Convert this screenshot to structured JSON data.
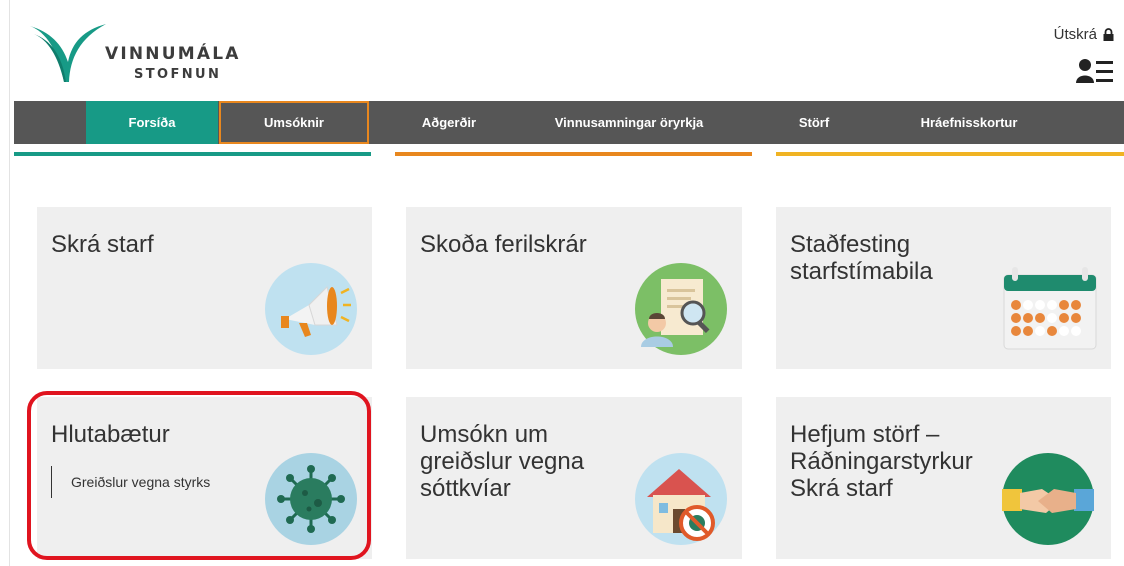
{
  "brand": {
    "line1": "VINNUMÁLA",
    "line2": "STOFNUN"
  },
  "header": {
    "logout_label": "Útskrá",
    "lock_icon": "lock-icon",
    "profile_icon": "profile-list-icon"
  },
  "nav": {
    "items": [
      {
        "label": "Forsíða",
        "state": "active"
      },
      {
        "label": "Umsóknir",
        "state": "outlined"
      },
      {
        "label": "Aðgerðir"
      },
      {
        "label": "Vinnusamningar öryrkja"
      },
      {
        "label": "Störf"
      },
      {
        "label": "Hráefnisskortur"
      }
    ]
  },
  "colors": {
    "green": "#179a86",
    "orange": "#e8871e",
    "yellow": "#f0b323",
    "nav_bg": "#565656",
    "highlight": "#e0141f"
  },
  "cards": [
    {
      "title": "Skrá starf",
      "icon": "megaphone-icon"
    },
    {
      "title": "Skoða ferilskrár",
      "icon": "resume-search-icon"
    },
    {
      "title": "Staðfesting starfstímabila",
      "icon": "calendar-icon"
    },
    {
      "title": "Hlutabætur",
      "subtitle": "Greiðslur vegna styrks",
      "icon": "virus-icon"
    },
    {
      "title": "Umsókn um greiðslur vegna sóttkvíar",
      "icon": "house-quarantine-icon"
    },
    {
      "title": "Hefjum störf – Ráðningarstyrkur Skrá starf",
      "icon": "handshake-icon"
    }
  ]
}
